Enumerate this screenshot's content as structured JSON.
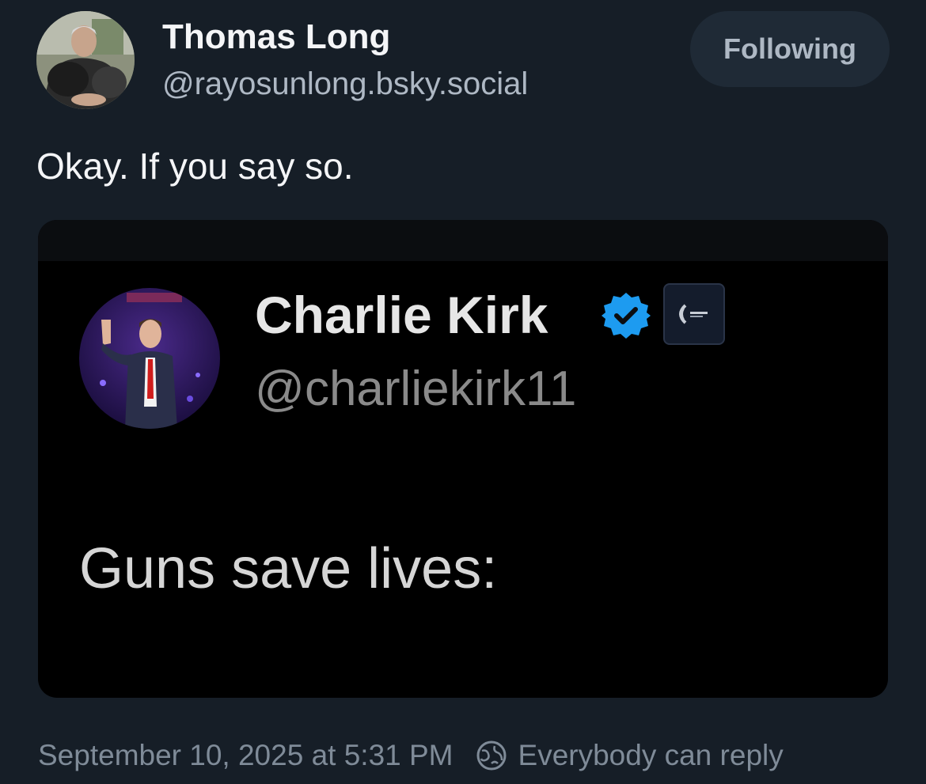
{
  "post": {
    "author_name": "Thomas Long",
    "author_handle": "@rayosunlong.bsky.social",
    "follow_button_label": "Following",
    "text": "Okay. If you say so.",
    "timestamp": "September 10, 2025 at 5:31 PM",
    "reply_setting": "Everybody can reply"
  },
  "embed": {
    "name": "Charlie Kirk",
    "handle": "@charliekirk11",
    "text": "Guns save lives:"
  },
  "icons": {
    "verified": "verified-check-icon",
    "globe": "globe-icon",
    "affiliate": "affiliate-badge-icon"
  },
  "colors": {
    "background": "#161e27",
    "verified_blue": "#1d9bf0",
    "muted_text": "#aeb8c4"
  }
}
